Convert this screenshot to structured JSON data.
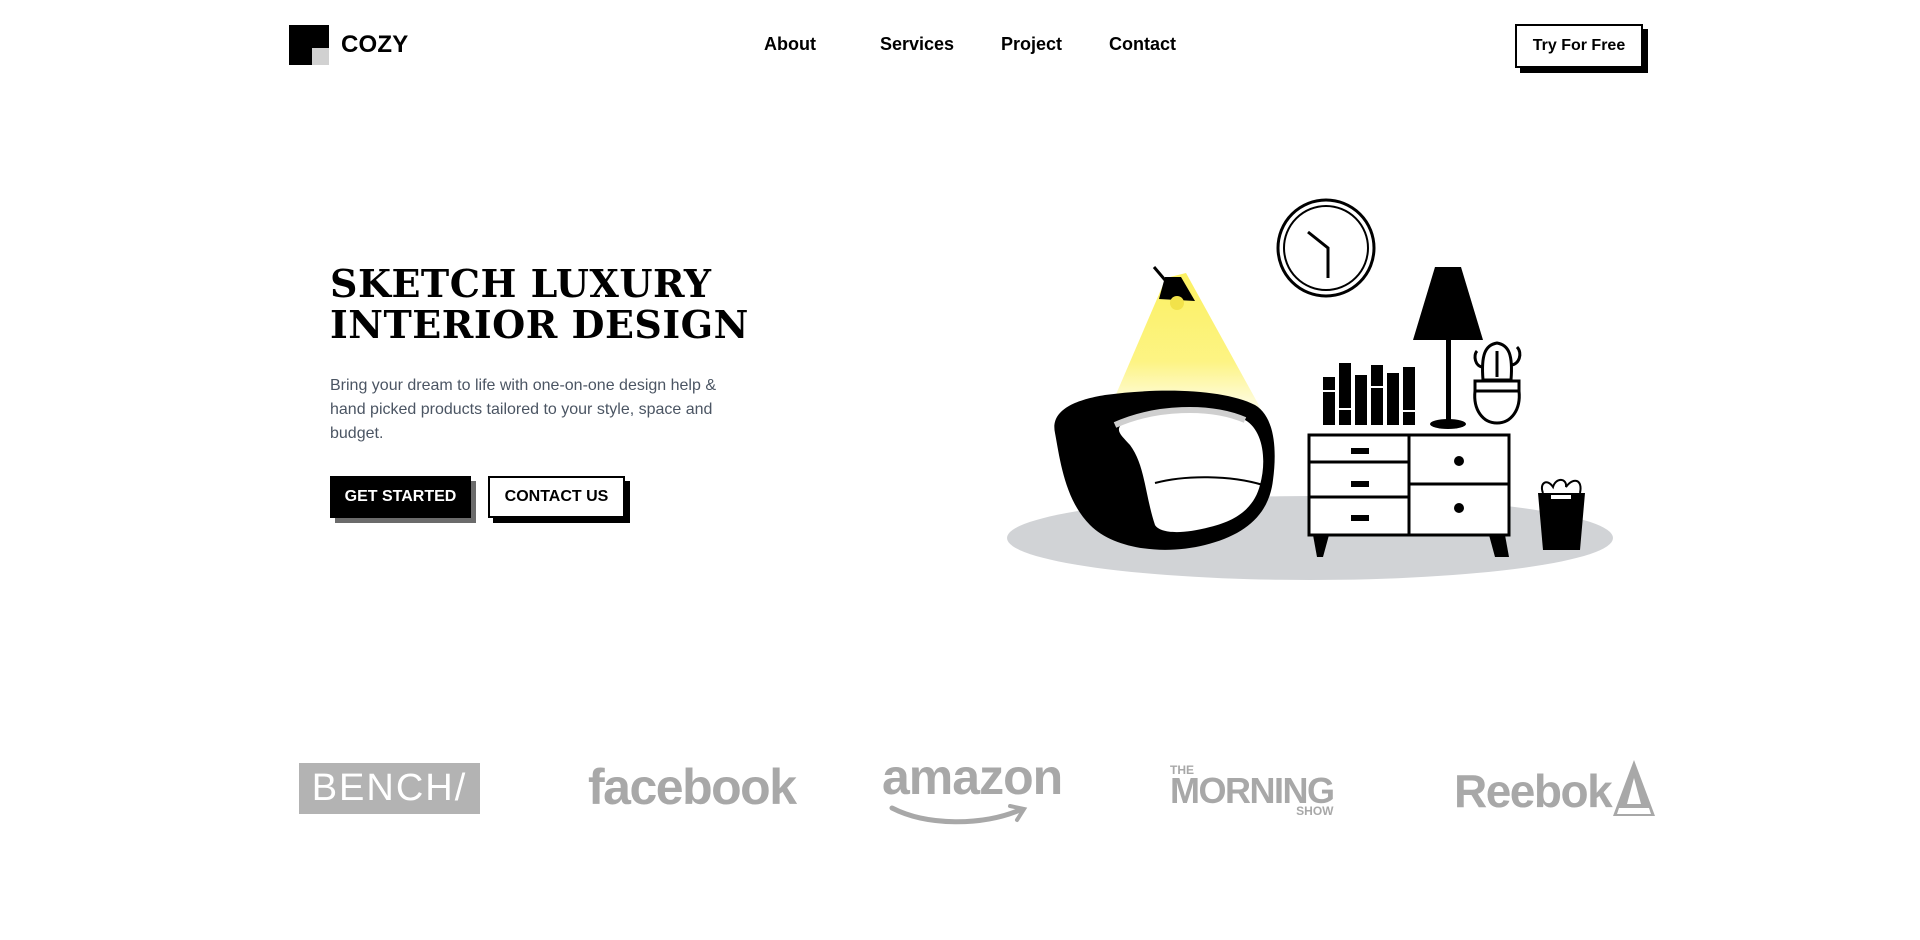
{
  "header": {
    "logo_text": "COZY",
    "nav": {
      "about": "About",
      "services": "Services",
      "project": "Project",
      "contact": "Contact"
    },
    "cta": "Try For Free"
  },
  "hero": {
    "title_line1": "SKETCH LUXURY",
    "title_line2": "INTERIOR DESIGN",
    "description": "Bring your dream to life with one-on-one design help & hand picked products tailored to your style, space and budget.",
    "primary_button": "GET STARTED",
    "secondary_button": "CONTACT US"
  },
  "brands": {
    "bench": "BENCH/",
    "facebook": "facebook",
    "amazon": "amazon",
    "morning_the": "THE",
    "morning_main": "MORNING",
    "morning_show": "SHOW",
    "reebok": "Reebok"
  },
  "colors": {
    "accent": "#000000",
    "lamp_light": "#fcf05a",
    "rug": "#d1d3d6",
    "logo_gray": "#a8a8a8"
  },
  "icons": [
    "logo-mark-icon",
    "interior-illustration"
  ]
}
